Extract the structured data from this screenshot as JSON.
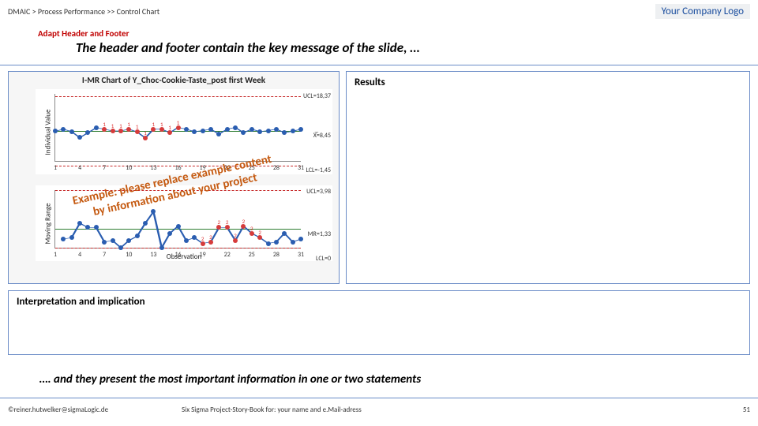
{
  "breadcrumb": "DMAIC > Process Performance >> Control Chart",
  "logo": "Your Company Logo",
  "adapt_label": "Adapt Header and Footer",
  "headline": "The header and footer contain the key message of the slide, …",
  "results_title": "Results",
  "interp_title": "Interpretation and implication",
  "stamp_line1": "Example: please replace example content",
  "stamp_line2": "by information about your project",
  "footline": "…. and they present the most important information in one or two statements",
  "footer_left": "©reiner.hutwelker@sigmaLogic.de",
  "footer_center": "Six Sigma Project-Story-Book for: your name and e.Mail-adress",
  "footer_page": "51",
  "chart_data": [
    {
      "type": "line",
      "title": "I-MR Chart of Y_Choc-Cookie-Taste_post first Week",
      "panel": "Individual Value",
      "x": [
        1,
        4,
        7,
        10,
        13,
        16,
        19,
        22,
        25,
        28,
        31
      ],
      "xlabel": "Observation",
      "ylabel": "Individual Value",
      "ylim": [
        0,
        19
      ],
      "center": 8.45,
      "ucl": 18.37,
      "lcl": -1.45,
      "center_label": "X̅=8,45",
      "ucl_label": "UCL=18,37",
      "lcl_label": "LCL=-1,45",
      "series": [
        {
          "name": "points",
          "values": [
            8.4,
            9.0,
            8.3,
            6.6,
            8.0,
            9.4,
            9.0,
            8.5,
            8.5,
            9.0,
            8.2,
            6.5,
            9.0,
            9.0,
            8.0,
            9.5,
            9.0,
            8.3,
            8.6,
            9.0,
            7.6,
            9.0,
            9.5,
            8.0,
            9.0,
            8.3,
            8.6,
            9.0,
            8.0,
            8.4,
            9.0
          ]
        }
      ],
      "flagged_indices": [
        6,
        7,
        8,
        9,
        10,
        11,
        12,
        13,
        14,
        15
      ],
      "flag_label": "1"
    },
    {
      "type": "line",
      "panel": "Moving Range",
      "x": [
        1,
        4,
        7,
        10,
        13,
        16,
        19,
        22,
        25,
        28,
        31
      ],
      "xlabel": "Observation",
      "ylabel": "Moving Range",
      "ylim": [
        0,
        4
      ],
      "center": 1.33,
      "ucl": 3.98,
      "lcl": 0,
      "center_label": "MR=1,33",
      "ucl_label": "UCL=3,98",
      "lcl_label": "LCL=0",
      "series": [
        {
          "name": "points",
          "values": [
            null,
            0.6,
            0.7,
            1.7,
            1.4,
            1.4,
            0.4,
            0.5,
            0.0,
            0.5,
            0.8,
            1.7,
            2.5,
            0.0,
            1.0,
            1.5,
            0.5,
            0.7,
            0.3,
            0.4,
            1.4,
            1.4,
            0.5,
            1.5,
            1.0,
            0.7,
            0.3,
            0.4,
            1.0,
            0.4,
            0.6
          ]
        }
      ],
      "flagged_indices": [
        18,
        19,
        20,
        21,
        22,
        23,
        24,
        25
      ],
      "flag_label": "2"
    }
  ]
}
